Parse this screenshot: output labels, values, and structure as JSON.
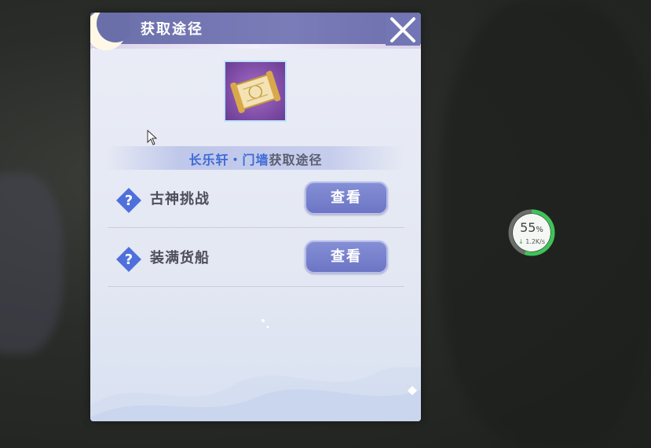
{
  "dialog": {
    "title": "获取途径",
    "subtitle_name": "长乐轩・门墙",
    "subtitle_rest": "获取途径",
    "sources": [
      {
        "label": "古神挑战",
        "button": "查看"
      },
      {
        "label": "装满货船",
        "button": "查看"
      }
    ]
  },
  "net_widget": {
    "percent": "55",
    "percent_unit": "%",
    "rate": "1.2K/s"
  },
  "colors": {
    "header": "#6a6faa",
    "accent_blue": "#3e6ad6",
    "button": "#7680cc",
    "question_icon": "#4f6fdc",
    "ring": "#3ec45a"
  },
  "icons": [
    "moon-icon",
    "close-icon",
    "scroll-item-icon",
    "question-icon",
    "cursor-icon",
    "download-arrow-icon"
  ]
}
